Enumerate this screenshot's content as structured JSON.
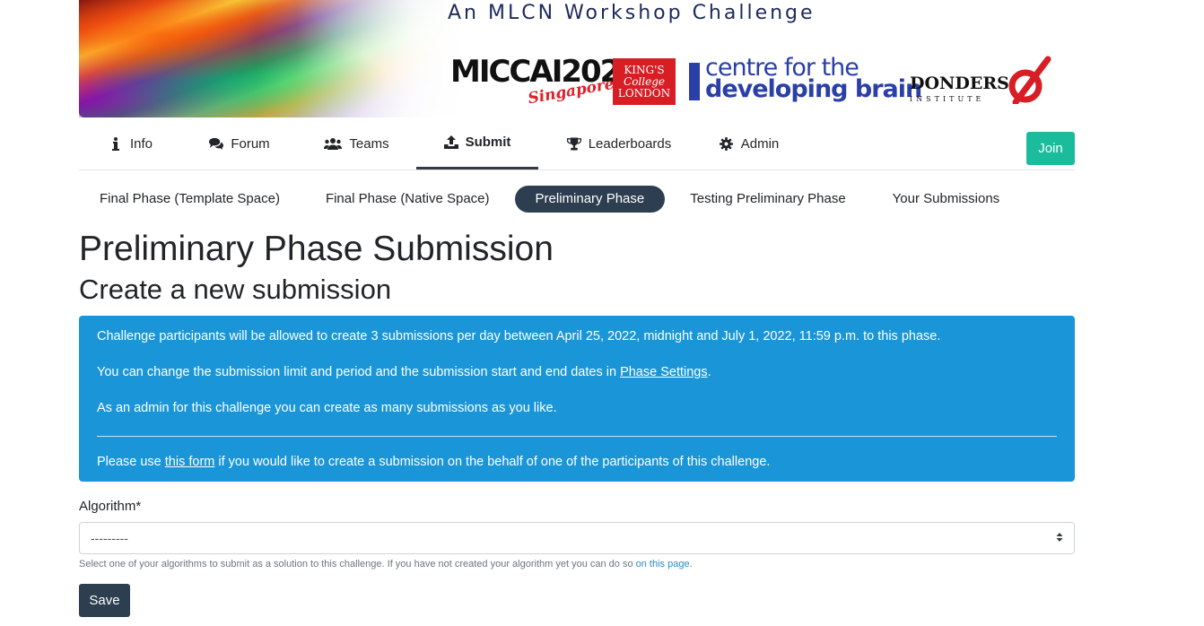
{
  "banner": {
    "title": "An MLCN Workshop Challenge",
    "logo_miccai": "MICCAI2022",
    "logo_miccai_sub": "Singapore",
    "logo_kcl_line1": "KING'S",
    "logo_kcl_line2": "College",
    "logo_kcl_line3": "LONDON",
    "logo_cdb_line1": "centre for the",
    "logo_cdb_line2": "developing brain",
    "logo_donders": "DONDERS",
    "logo_donders_sub": "INSTITUTE"
  },
  "nav": {
    "items": [
      {
        "label": "Info",
        "icon": "info-icon"
      },
      {
        "label": "Forum",
        "icon": "comments-icon"
      },
      {
        "label": "Teams",
        "icon": "users-icon"
      },
      {
        "label": "Submit",
        "icon": "upload-icon",
        "active": true
      },
      {
        "label": "Leaderboards",
        "icon": "trophy-icon"
      },
      {
        "label": "Admin",
        "icon": "gear-icon"
      }
    ],
    "join_label": "Join"
  },
  "phases": [
    {
      "label": "Final Phase (Template Space)"
    },
    {
      "label": "Final Phase (Native Space)"
    },
    {
      "label": "Preliminary Phase",
      "active": true
    },
    {
      "label": "Testing Preliminary Phase"
    },
    {
      "label": "Your Submissions"
    }
  ],
  "page_title": "Preliminary Phase Submission",
  "section_title": "Create a new submission",
  "alert": {
    "line1": "Challenge participants will be allowed to create 3 submissions per day between April 25, 2022, midnight and July 1, 2022, 11:59 p.m. to this phase.",
    "line2_prefix": "You can change the submission limit and period and the submission start and end dates in ",
    "line2_link": "Phase Settings",
    "line2_suffix": ".",
    "line3": "As an admin for this challenge you can create as many submissions as you like.",
    "line4_prefix": "Please use ",
    "line4_link": "this form",
    "line4_suffix": " if you would like to create a submission on the behalf of one of the participants of this challenge."
  },
  "form": {
    "algorithm_label": "Algorithm*",
    "algorithm_value": "---------",
    "help_prefix": "Select one of your algorithms to submit as a solution to this challenge. If you have not created your algorithm yet you can do so ",
    "help_link": "on this page",
    "help_suffix": ".",
    "save_label": "Save"
  },
  "colors": {
    "alert_bg": "#1a96d8",
    "join_bg": "#1abc9c",
    "dark": "#2c3e50"
  }
}
